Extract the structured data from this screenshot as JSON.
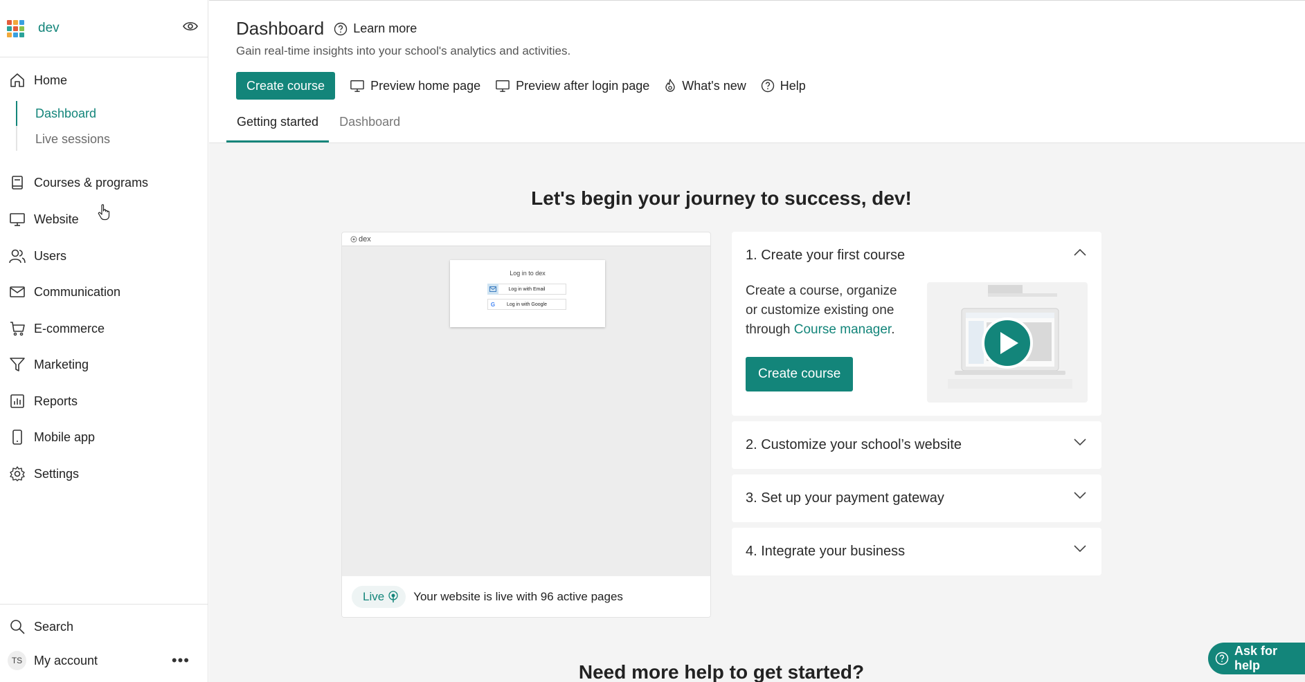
{
  "sidebar": {
    "school_name": "dev",
    "home_label": "Home",
    "sub_items": [
      "Dashboard",
      "Live sessions"
    ],
    "items": [
      {
        "label": "Courses & programs",
        "icon": "book-icon"
      },
      {
        "label": "Website",
        "icon": "monitor-icon"
      },
      {
        "label": "Users",
        "icon": "users-icon"
      },
      {
        "label": "Communication",
        "icon": "mail-icon"
      },
      {
        "label": "E-commerce",
        "icon": "cart-icon"
      },
      {
        "label": "Marketing",
        "icon": "funnel-icon"
      },
      {
        "label": "Reports",
        "icon": "chart-icon"
      },
      {
        "label": "Mobile app",
        "icon": "phone-icon"
      },
      {
        "label": "Settings",
        "icon": "gear-icon"
      }
    ],
    "search_label": "Search",
    "account_initials": "TS",
    "account_label": "My account",
    "more_label": "•••"
  },
  "header": {
    "title": "Dashboard",
    "learn_more": "Learn more",
    "subtitle": "Gain real-time insights into your school's analytics and activities.",
    "create_course": "Create course",
    "preview_home": "Preview home page",
    "preview_after_login": "Preview after login page",
    "whats_new": "What's new",
    "help": "Help"
  },
  "tabs": [
    "Getting started",
    "Dashboard"
  ],
  "main": {
    "journey_heading": "Let's begin your journey to success, dev!",
    "preview": {
      "site_name": "dex",
      "login_title": "Log in to dex",
      "login_email": "Log in with Email",
      "login_google": "Log in with Google",
      "live_label": "Live",
      "live_text": "Your website is live with 96 active pages"
    },
    "steps": [
      {
        "title": "1. Create your first course",
        "body_before_link": "Create a course, organize or customize existing one through ",
        "link": "Course manager",
        "body_after_link": ".",
        "button": "Create course"
      },
      {
        "title": "2. Customize your school’s website"
      },
      {
        "title": "3. Set up your payment gateway"
      },
      {
        "title": "4. Integrate your business"
      }
    ],
    "more_help_heading": "Need more help to get started?"
  },
  "ask_help": "Ask for help",
  "colors": {
    "accent": "#13857a",
    "background": "#f4f4f4"
  }
}
